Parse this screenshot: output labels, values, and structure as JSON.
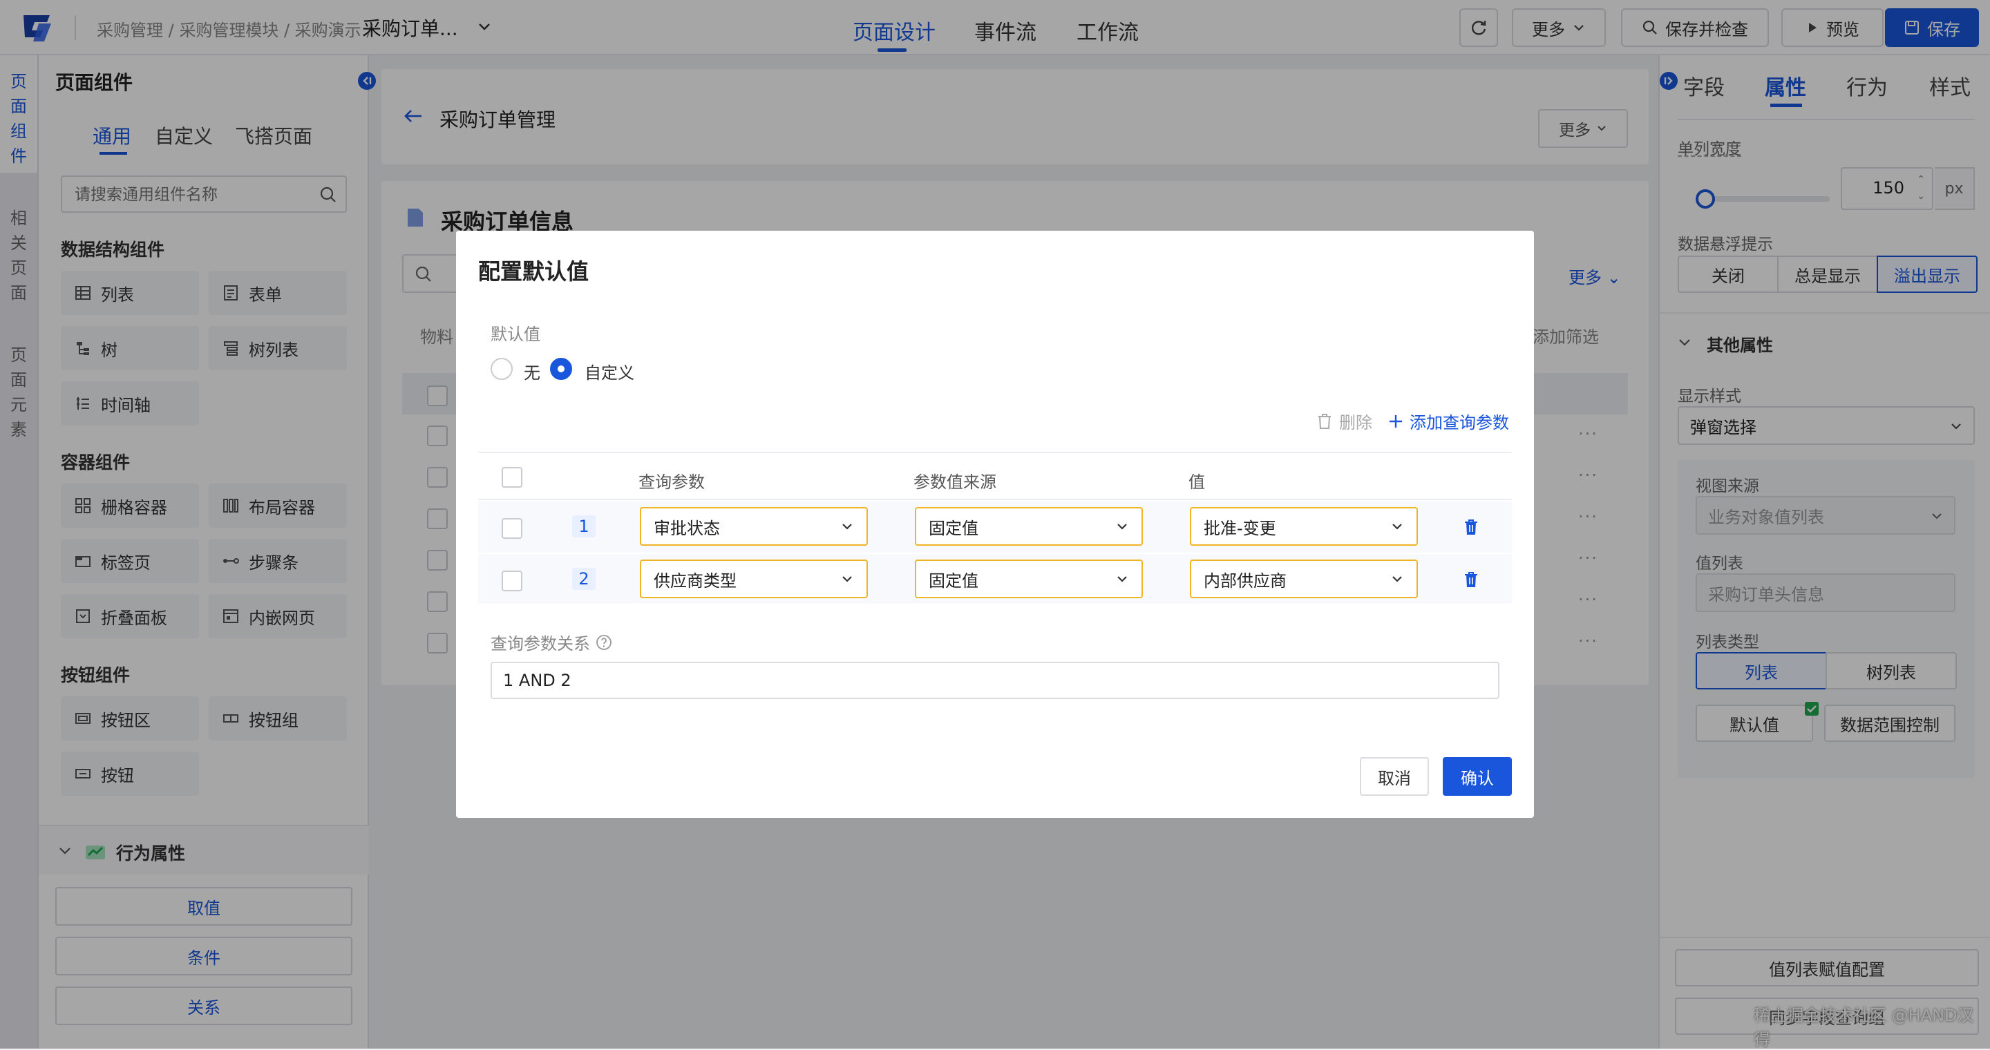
{
  "topbar": {
    "breadcrumb": "采购管理 / 采购管理模块 / 采购演示 /",
    "current": "采购订单...",
    "tabs": [
      "页面设计",
      "事件流",
      "工作流"
    ],
    "more": "更多",
    "save_check": "保存并检查",
    "preview": "预览",
    "save": "保存"
  },
  "rail": [
    "页面组件",
    "相关页面",
    "页面元素"
  ],
  "components": {
    "title": "页面组件",
    "tabs": [
      "通用",
      "自定义",
      "飞搭页面"
    ],
    "search_placeholder": "请搜索通用组件名称",
    "sections": {
      "data": "数据结构组件",
      "container": "容器组件",
      "button": "按钮组件"
    },
    "data_items": [
      "列表",
      "表单",
      "树",
      "树列表",
      "时间轴"
    ],
    "container_items": [
      "栅格容器",
      "布局容器",
      "标签页",
      "步骤条",
      "折叠面板",
      "内嵌网页"
    ],
    "button_items": [
      "按钮区",
      "按钮组",
      "按钮"
    ],
    "behavior_title": "行为属性",
    "behavior_buttons": [
      "取值",
      "条件",
      "关系"
    ]
  },
  "center": {
    "header_title": "采购订单管理",
    "header_more": "更多",
    "section_title": "采购订单信息",
    "more": "更多",
    "col_hint": "物料",
    "add_filter": "添加筛选"
  },
  "modal": {
    "title": "配置默认值",
    "default_label": "默认值",
    "radio_none": "无",
    "radio_custom": "自定义",
    "delete": "删除",
    "add_param": "添加查询参数",
    "headers": [
      "查询参数",
      "参数值来源",
      "值"
    ],
    "rows": [
      {
        "index": "1",
        "param": "审批状态",
        "source": "固定值",
        "value": "批准-变更"
      },
      {
        "index": "2",
        "param": "供应商类型",
        "source": "固定值",
        "value": "内部供应商"
      }
    ],
    "relation_label": "查询参数关系",
    "relation_value": "1 AND 2",
    "cancel": "取消",
    "confirm": "确认"
  },
  "right": {
    "tabs": [
      "字段",
      "属性",
      "行为",
      "样式"
    ],
    "column_width_label": "单列宽度",
    "column_width_value": "150",
    "unit": "px",
    "slider_level": 0.05,
    "tooltip_label": "数据悬浮提示",
    "tooltip_options": [
      "关闭",
      "总是显示",
      "溢出显示"
    ],
    "other_props": "其他属性",
    "display_style_label": "显示样式",
    "display_style_value": "弹窗选择",
    "view_source_label": "视图来源",
    "view_source_value": "业务对象值列表",
    "value_list_label": "值列表",
    "value_list_value": "采购订单头信息",
    "list_type_label": "列表类型",
    "list_type_options": [
      "列表",
      "树列表"
    ],
    "default_value_btn": "默认值",
    "data_range_btn": "数据范围控制",
    "assign_btn": "值列表赋值配置",
    "bottom_btn": "同步字段查询组",
    "watermark": "稀土掘金技术社区 @HAND汉得"
  },
  "colors": {
    "primary": "#1a56db",
    "warning_border": "#f0b429",
    "success": "#1fa84f"
  }
}
